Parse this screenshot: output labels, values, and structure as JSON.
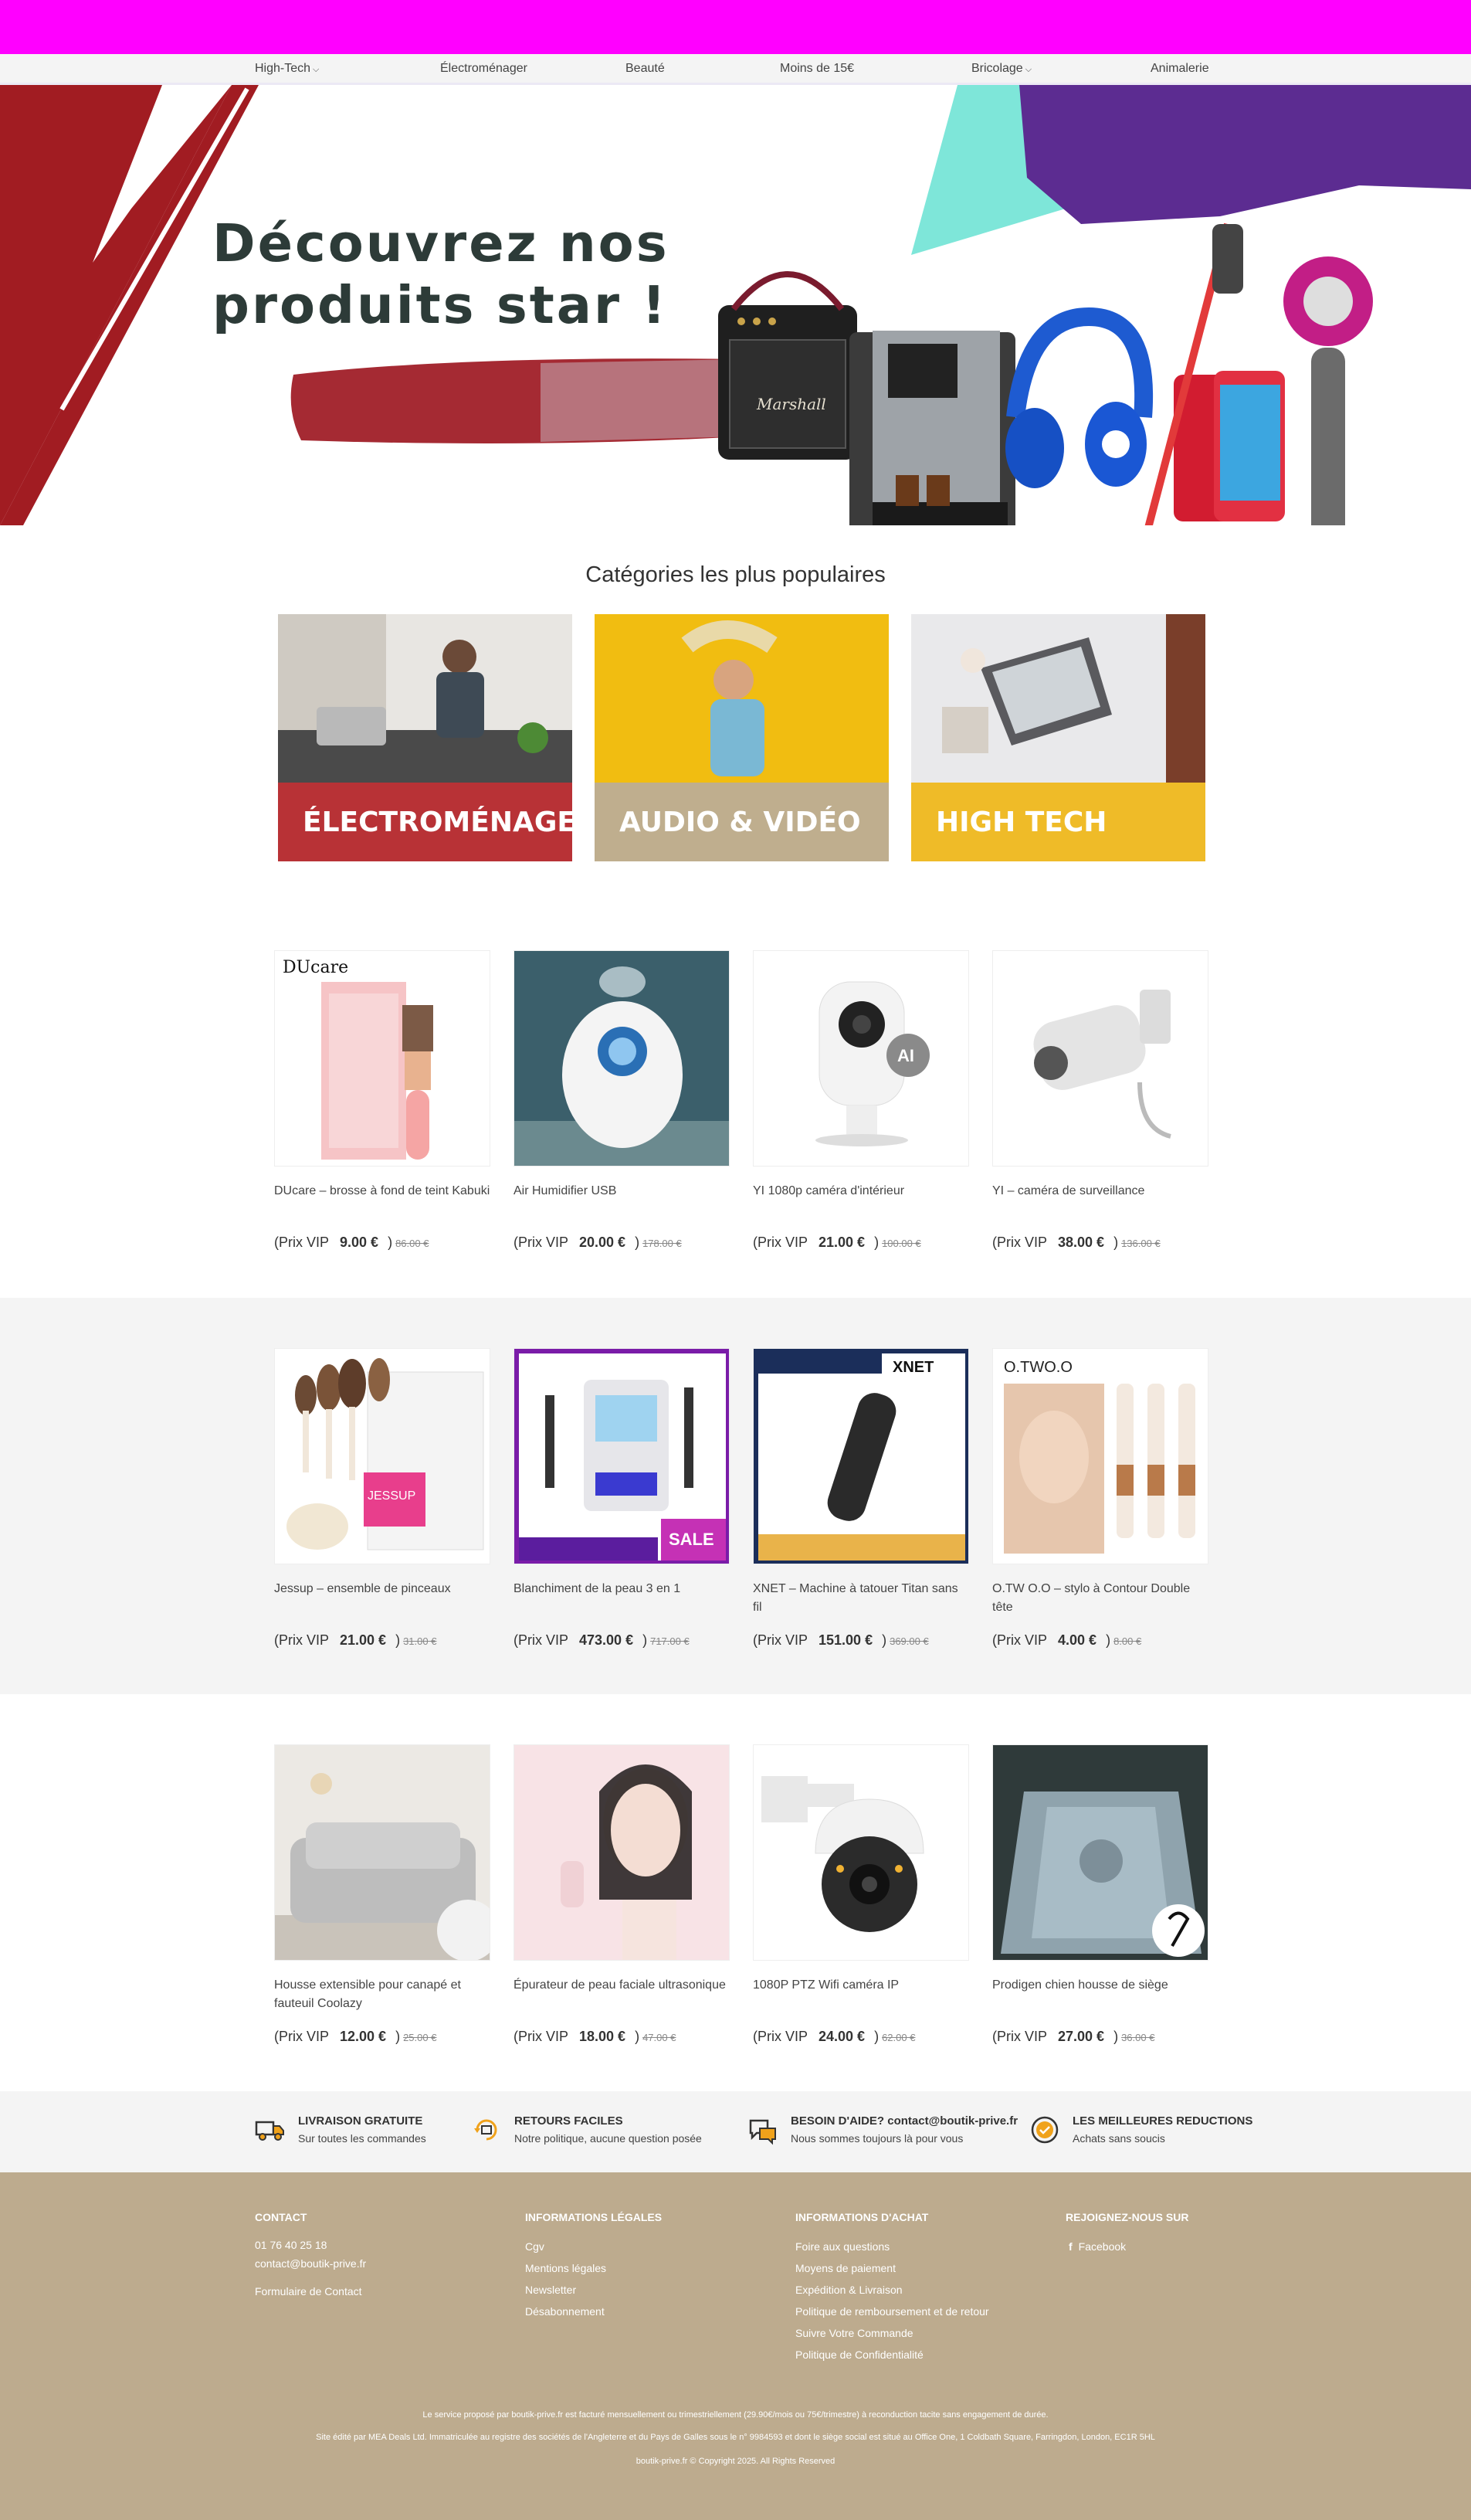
{
  "nav": {
    "items": [
      {
        "label": "High-Tech",
        "dropdown": true
      },
      {
        "label": "Électroménager",
        "dropdown": false
      },
      {
        "label": "Beauté",
        "dropdown": false
      },
      {
        "label": "Moins de 15€",
        "dropdown": false
      },
      {
        "label": "Bricolage",
        "dropdown": true
      },
      {
        "label": "Animalerie",
        "dropdown": false
      }
    ],
    "chevron": "⌵"
  },
  "hero": {
    "line1": "Découvrez nos",
    "line2": "produits star !",
    "speaker_brand": "Marshall"
  },
  "categories": {
    "title": "Catégories les plus populaires",
    "items": [
      {
        "label": "ÉLECTROMÉNAGER",
        "color": "#b83236"
      },
      {
        "label": "AUDIO & VIDÉO",
        "color": "#bfae8e"
      },
      {
        "label": "HIGH TECH",
        "color": "#efbb28"
      }
    ]
  },
  "price_prefix": "(Prix VIP",
  "price_close": ")",
  "products": [
    [
      {
        "name": "DUcare – brosse à fond de teint Kabuki",
        "price": "9.00 €",
        "old": "86.00 €",
        "img_text": "DUcare"
      },
      {
        "name": "Air Humidifier USB",
        "price": "20.00 €",
        "old": "178.00 €"
      },
      {
        "name": "YI 1080p caméra d'intérieur",
        "price": "21.00 €",
        "old": "100.00 €",
        "img_text": "AI"
      },
      {
        "name": "YI – caméra de surveillance",
        "price": "38.00 €",
        "old": "136.00 €"
      }
    ],
    [
      {
        "name": "Jessup – ensemble de pinceaux",
        "price": "21.00 €",
        "old": "31.00 €",
        "img_text": "JESSUP"
      },
      {
        "name": "Blanchiment de la peau 3 en 1",
        "price": "473.00 €",
        "old": "717.00 €",
        "img_text": "SALE"
      },
      {
        "name": "XNET – Machine à tatouer Titan sans fil",
        "price": "151.00 €",
        "old": "369.00 €",
        "img_text": "XNET"
      },
      {
        "name": "O.TW O.O – stylo à Contour Double tête",
        "price": "4.00 €",
        "old": "8.00 €",
        "img_text": "O.TWO.O"
      }
    ],
    [
      {
        "name": "Housse extensible pour canapé et fauteuil Coolazy",
        "price": "12.00 €",
        "old": "25.00 €"
      },
      {
        "name": "Épurateur de peau faciale ultrasonique",
        "price": "18.00 €",
        "old": "47.00 €"
      },
      {
        "name": "1080P PTZ Wifi caméra IP",
        "price": "24.00 €",
        "old": "62.00 €"
      },
      {
        "name": "Prodigen chien housse de siège",
        "price": "27.00 €",
        "old": "36.00 €"
      }
    ]
  ],
  "features": [
    {
      "icon": "truck-icon",
      "title": "LIVRAISON GRATUITE",
      "sub": "Sur toutes les commandes"
    },
    {
      "icon": "return-icon",
      "title": "RETOURS FACILES",
      "sub": "Notre politique, aucune question posée"
    },
    {
      "icon": "chat-icon",
      "title": "BESOIN D'AIDE? contact@boutik-prive.fr",
      "sub": "Nous sommes toujours là pour vous"
    },
    {
      "icon": "discount-badge-icon",
      "title": "LES MEILLEURES REDUCTIONS",
      "sub": "Achats sans soucis"
    }
  ],
  "footer": {
    "contact": {
      "title": "CONTACT",
      "phone": "01 76 40 25 18",
      "email": "contact@boutik-prive.fr",
      "form": "Formulaire de Contact"
    },
    "legal": {
      "title": "INFORMATIONS LÉGALES",
      "links": [
        "Cgv",
        "Mentions légales",
        "Newsletter",
        "Désabonnement"
      ]
    },
    "purchase": {
      "title": "INFORMATIONS D'ACHAT",
      "links": [
        "Foire aux questions",
        "Moyens de paiement",
        "Expédition & Livraison",
        "Politique de remboursement et de retour",
        "Suivre Votre Commande",
        "Politique de Confidentialité"
      ]
    },
    "social": {
      "title": "REJOIGNEZ-NOUS SUR",
      "facebook": "Facebook",
      "fb_glyph": "f"
    },
    "notice1": "Le service proposé par boutik-prive.fr est facturé mensuellement ou trimestriellement (29.90€/mois ou 75€/trimestre) à reconduction tacite sans engagement de durée.",
    "notice2": "Site édité par MEA Deals Ltd. Immatriculée au registre des sociétés de l'Angleterre et du Pays de Galles sous le n° 9984593 et dont le siège social est situé au Office One, 1 Coldbath Square, Farringdon, London, EC1R 5HL",
    "copyright": "boutik-prive.fr © Copyright 2025. All Rights Reserved"
  }
}
